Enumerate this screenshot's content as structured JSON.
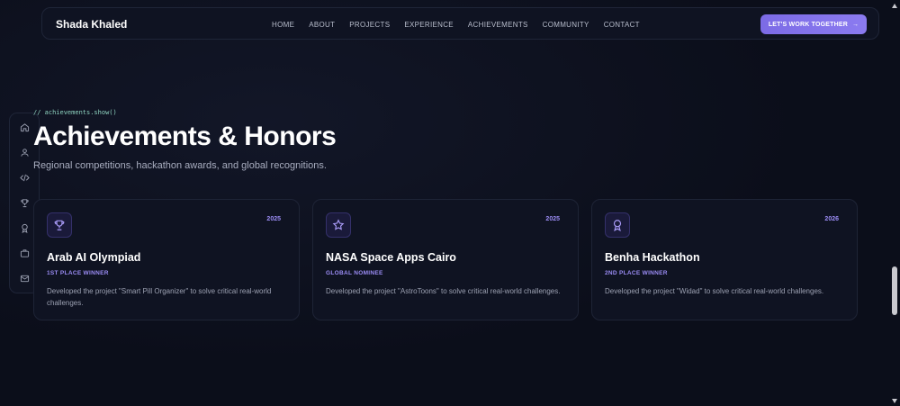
{
  "navbar": {
    "brand": "Shada Khaled",
    "links": [
      "HOME",
      "ABOUT",
      "PROJECTS",
      "EXPERIENCE",
      "ACHIEVEMENTS",
      "COMMUNITY",
      "CONTACT"
    ],
    "cta_label": "LET'S WORK TOGETHER",
    "cta_arrow": "→",
    "cta_color": "#7c6be6"
  },
  "sidebar": {
    "icons": [
      "home-icon",
      "user-icon",
      "code-icon",
      "trophy-icon",
      "award-icon",
      "briefcase-icon",
      "mail-icon"
    ]
  },
  "section": {
    "code_tag": "// achievements.show()",
    "title": "Achievements & Honors",
    "subtitle": "Regional competitions, hackathon awards, and global recognitions."
  },
  "cards": [
    {
      "icon": "trophy-icon",
      "year": "2025",
      "title": "Arab AI Olympiad",
      "award": "1ST PLACE WINNER",
      "description": "Developed the project \"Smart Pill Organizer\" to solve critical real-world challenges."
    },
    {
      "icon": "star-icon",
      "year": "2025",
      "title": "NASA Space Apps Cairo",
      "award": "GLOBAL NOMINEE",
      "description": "Developed the project \"AstroToons\" to solve critical real-world challenges."
    },
    {
      "icon": "award-icon",
      "year": "2026",
      "title": "Benha Hackathon",
      "award": "2ND PLACE WINNER",
      "description": "Developed the project \"Widad\" to solve critical real-world challenges."
    }
  ],
  "colors": {
    "background": "#0b0e1a",
    "accent": "#9b8cf5",
    "code_tag": "#8fd4c0"
  }
}
